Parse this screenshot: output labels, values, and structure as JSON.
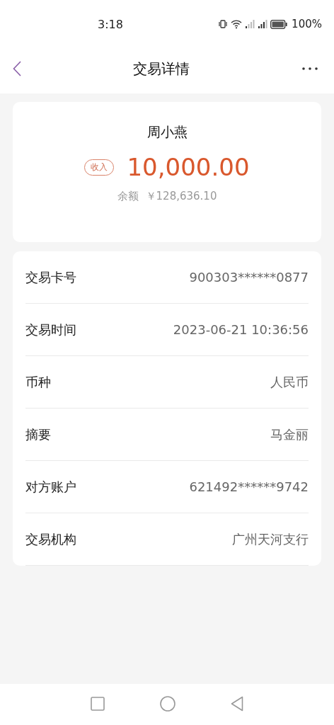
{
  "status_bar": {
    "time": "3:18",
    "battery": "100%"
  },
  "header": {
    "title": "交易详情"
  },
  "summary": {
    "name": "周小燕",
    "tag": "收入",
    "amount": "10,000.00",
    "balance_label": "余额",
    "balance": "￥128,636.10"
  },
  "details": [
    {
      "label": "交易卡号",
      "value": "900303******0877"
    },
    {
      "label": "交易时间",
      "value": "2023-06-21 10:36:56"
    },
    {
      "label": "币种",
      "value": "人民币"
    },
    {
      "label": "摘要",
      "value": "马金丽"
    },
    {
      "label": "对方账户",
      "value": "621492******9742"
    },
    {
      "label": "交易机构",
      "value": "广州天河支行"
    }
  ]
}
